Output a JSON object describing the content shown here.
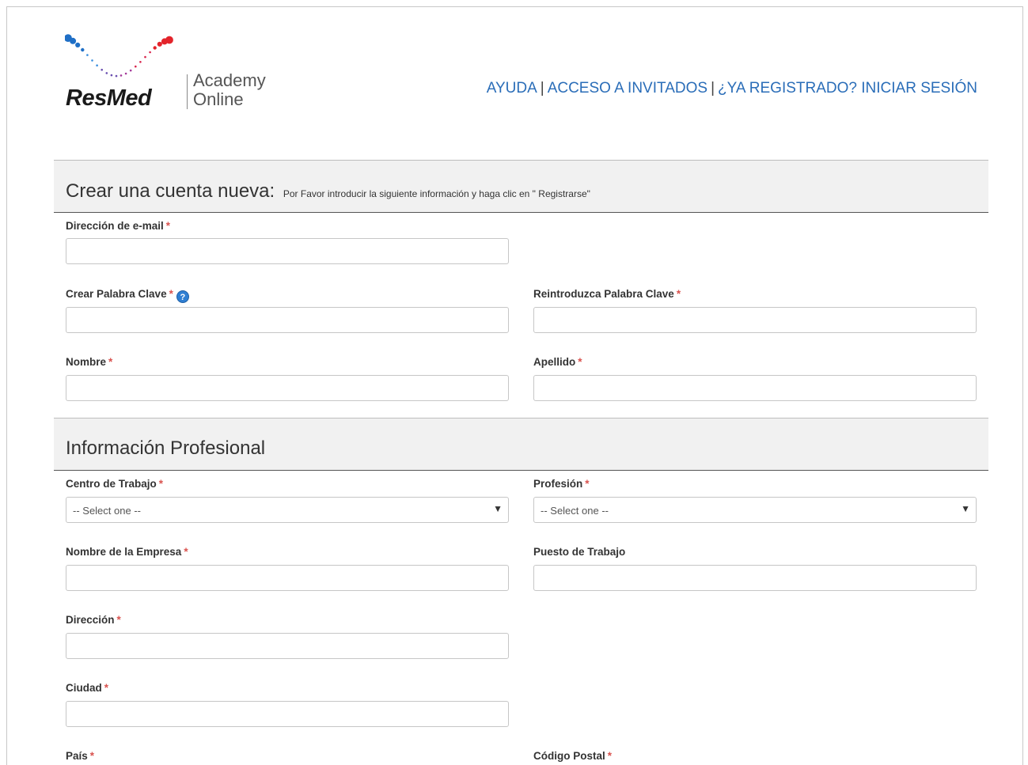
{
  "logo": {
    "brand": "ResMed",
    "product_line1": "Academy",
    "product_line2": "Online",
    "dot_colors": [
      "#1f6fc6",
      "#3a8fde",
      "#6a4fb0",
      "#a4399a",
      "#d8264d",
      "#e3242b"
    ]
  },
  "top_links": {
    "help": "AYUDA",
    "guest": "ACCESO A INVITADOS",
    "login": "¿YA REGISTRADO? INICIAR SESIÓN",
    "separator": "|"
  },
  "account_section": {
    "title": "Crear una cuenta nueva:",
    "subtitle": "Por Favor introducir la siguiente información y haga clic en \" Registrarse\""
  },
  "fields": {
    "email": {
      "label": "Dirección de e-mail",
      "required": "*",
      "value": ""
    },
    "password": {
      "label": "Crear Palabra Clave",
      "required": "*",
      "help": "?",
      "value": ""
    },
    "password_confirm": {
      "label": "Reintroduzca Palabra Clave",
      "required": "*",
      "value": ""
    },
    "first_name": {
      "label": "Nombre",
      "required": "*",
      "value": ""
    },
    "last_name": {
      "label": "Apellido",
      "required": "*",
      "value": ""
    }
  },
  "professional_section": {
    "title": "Información Profesional"
  },
  "professional_fields": {
    "workplace": {
      "label": "Centro de Trabajo",
      "required": "*",
      "selected": "-- Select one --"
    },
    "profession": {
      "label": "Profesión",
      "required": "*",
      "selected": "-- Select one --"
    },
    "company": {
      "label": "Nombre de la Empresa",
      "required": "*",
      "value": ""
    },
    "job_title": {
      "label": "Puesto de Trabajo",
      "value": ""
    },
    "address": {
      "label": "Dirección",
      "required": "*",
      "value": ""
    },
    "city": {
      "label": "Ciudad",
      "required": "*",
      "value": ""
    },
    "country": {
      "label": "País",
      "required": "*"
    },
    "postal_code": {
      "label": "Código Postal",
      "required": "*"
    }
  },
  "colors": {
    "link": "#2a6db8",
    "required": "#d9534f",
    "section_bg": "#f1f1f1"
  }
}
